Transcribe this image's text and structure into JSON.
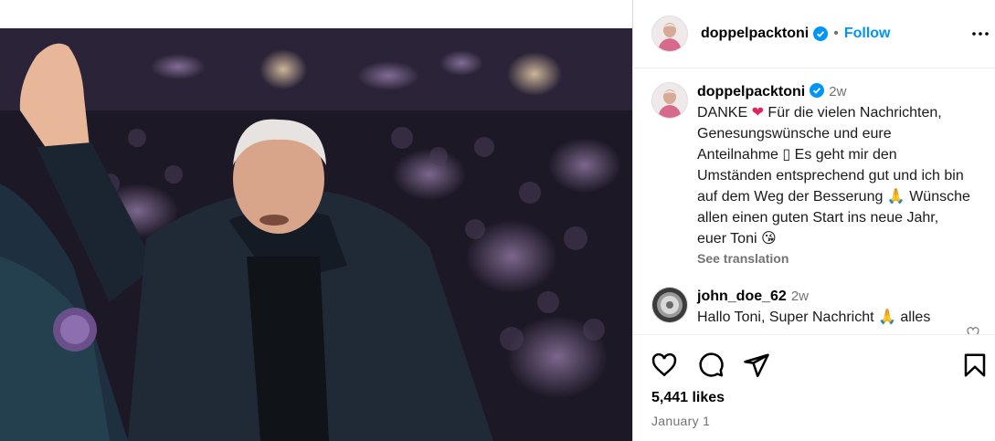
{
  "post": {
    "username": "doppelpacktoni",
    "follow_label": "Follow",
    "separator": "•",
    "caption_time": "2w",
    "caption_line1": "DANKE",
    "caption_line1b": " Für die vielen Nachrichten,",
    "caption_rest": "Genesungswünsche und eure Anteilnahme ▯ Es geht mir den Umständen entsprechend gut und ich bin auf dem Weg der Besserung",
    "caption_end": "Wünsche allen einen guten Start ins neue Jahr, euer Toni",
    "see_translation": "See translation",
    "likes": "5,441 likes",
    "date": "January 1"
  },
  "comments": [
    {
      "username": "john_doe_62",
      "time": "2w",
      "text": "Hallo Toni, Super Nachricht",
      "text_end": "alles"
    }
  ],
  "icons": {
    "verified": "verified-badge-icon",
    "more": "more-options-icon",
    "like": "heart-icon",
    "comment": "comment-icon",
    "share": "share-icon",
    "save": "bookmark-icon"
  },
  "colors": {
    "accent": "#0095f6",
    "verified": "#0095f6",
    "muted": "#737373",
    "heart": "#e0245e"
  }
}
